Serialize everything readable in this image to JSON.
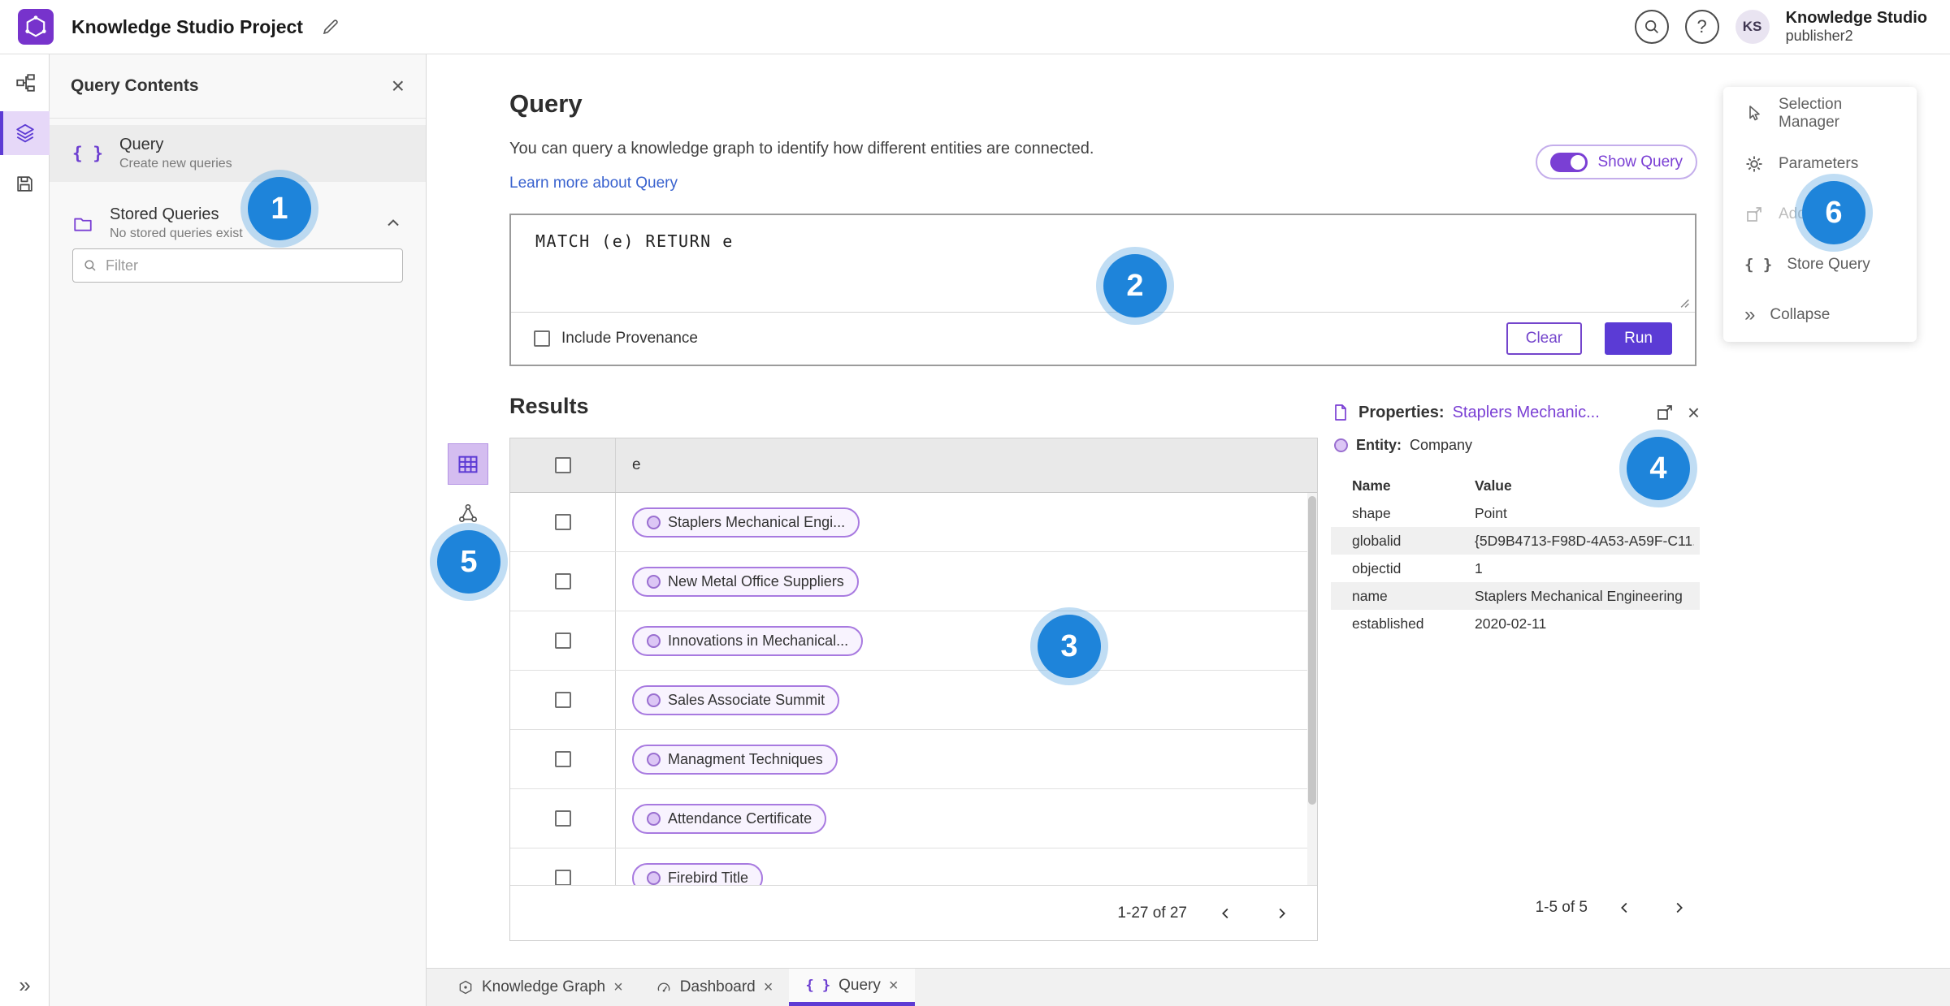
{
  "header": {
    "title": "Knowledge Studio Project",
    "account_name": "Knowledge Studio",
    "account_user": "publisher2",
    "avatar_initials": "KS",
    "help_glyph": "?"
  },
  "left_panel": {
    "title": "Query Contents",
    "query_item": {
      "label": "Query",
      "description": "Create new queries"
    },
    "stored_queries": {
      "label": "Stored Queries",
      "description": "No stored queries exist"
    },
    "filter_placeholder": "Filter"
  },
  "query_section": {
    "title": "Query",
    "description": "You can query a knowledge graph to identify how different entities are connected.",
    "learn_more": "Learn more about Query",
    "show_query_label": "Show Query",
    "code": "MATCH (e) RETURN e",
    "include_provenance": "Include Provenance",
    "clear_label": "Clear",
    "run_label": "Run"
  },
  "results": {
    "title": "Results",
    "column_header": "e",
    "rows": [
      "Staplers Mechanical Engi...",
      "New Metal Office Suppliers",
      "Innovations in Mechanical...",
      "Sales Associate Summit",
      "Managment Techniques",
      "Attendance Certificate",
      "Firebird Title"
    ],
    "pagination": "1-27 of 27"
  },
  "properties": {
    "label": "Properties:",
    "entity_link": "Staplers Mechanic...",
    "entity_key": "Entity:",
    "entity_value": "Company",
    "col_name": "Name",
    "col_value": "Value",
    "rows": [
      {
        "name": "shape",
        "value": "Point"
      },
      {
        "name": "globalid",
        "value": "{5D9B4713-F98D-4A53-A59F-C11..."
      },
      {
        "name": "objectid",
        "value": "1"
      },
      {
        "name": "name",
        "value": "Staplers Mechanical Engineering"
      },
      {
        "name": "established",
        "value": "2020-02-11"
      }
    ],
    "pagination": "1-5 of 5"
  },
  "right_menu": {
    "items": [
      "Selection Manager",
      "Parameters",
      "Add To Map",
      "Store Query",
      "Collapse"
    ]
  },
  "bottom_tabs": [
    {
      "label": "Knowledge Graph"
    },
    {
      "label": "Dashboard"
    },
    {
      "label": "Query"
    }
  ],
  "annotations": [
    "1",
    "2",
    "3",
    "4",
    "5",
    "6"
  ],
  "glyphs": {
    "close": "×",
    "collapse": "»"
  },
  "colors": {
    "accent_purple": "#5d3bd4",
    "annotation_blue": "#1e84da",
    "link_blue": "#3a63cf"
  }
}
